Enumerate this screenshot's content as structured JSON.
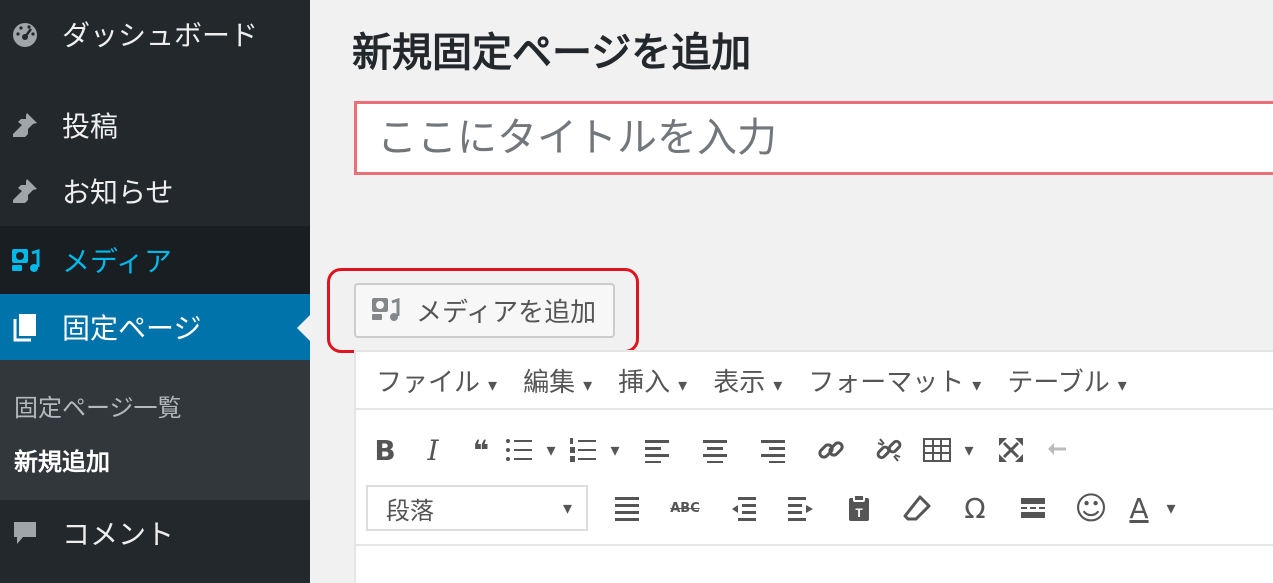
{
  "sidebar": {
    "items": [
      {
        "label": "ダッシュボード",
        "icon": "dashboard-icon"
      },
      {
        "label": "投稿",
        "icon": "pin-icon"
      },
      {
        "label": "お知らせ",
        "icon": "pin-icon"
      },
      {
        "label": "メディア",
        "icon": "media-icon"
      },
      {
        "label": "固定ページ",
        "icon": "page-icon"
      },
      {
        "label": "コメント",
        "icon": "comment-icon"
      }
    ],
    "submenu": [
      {
        "label": "固定ページ一覧"
      },
      {
        "label": "新規追加"
      }
    ]
  },
  "main": {
    "heading": "新規固定ページを追加",
    "title_placeholder": "ここにタイトルを入力",
    "add_media_label": "メディアを追加",
    "menubar": [
      {
        "label": "ファイル"
      },
      {
        "label": "編集"
      },
      {
        "label": "挿入"
      },
      {
        "label": "表示"
      },
      {
        "label": "フォーマット"
      },
      {
        "label": "テーブル"
      }
    ],
    "caret": "▾",
    "toolbar1": {
      "bold": "B",
      "italic": "I",
      "quote": "❝"
    },
    "toolbar2": {
      "format_value": "段落",
      "strike": "ABC",
      "special_char": "Ω",
      "emoji": "☺",
      "text_color": "A"
    }
  },
  "colors": {
    "sidebar_bg": "#23282d",
    "active_bg": "#0073aa",
    "media_text": "#00b9eb",
    "highlight": "#e0141e",
    "title_border": "#ec6e76"
  }
}
